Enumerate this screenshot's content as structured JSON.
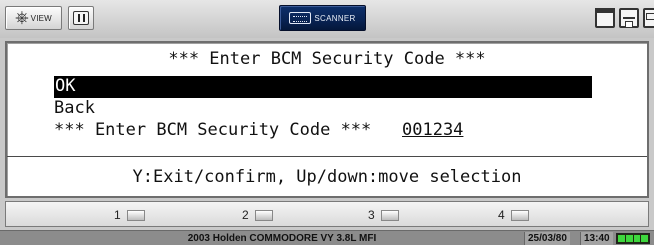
{
  "toolbar": {
    "view_label": "VIEW",
    "scanner_label": "SCANNER",
    "icons": [
      "view-icon",
      "pause-icon",
      "scanner-icon",
      "window-icon",
      "print-icon",
      "save-icon"
    ]
  },
  "screen": {
    "title": "*** Enter BCM Security Code ***",
    "options": [
      "OK",
      "Back"
    ],
    "selected_option": "OK",
    "code_prompt": "*** Enter BCM Security Code ***",
    "code_value": "001234",
    "help_text": "Y:Exit/confirm, Up/down:move selection"
  },
  "function_keys": [
    "1",
    "2",
    "3",
    "4"
  ],
  "status": {
    "vehicle": "2003 Holden COMMODORE VY 3.8L MFI",
    "date": "25/03/80",
    "time": "13:40",
    "battery_level": 1.0
  },
  "colors": {
    "selection_bg": "#000000",
    "selection_fg": "#ffffff",
    "scanner_bg": "#082252",
    "battery": "#3ed73e"
  }
}
